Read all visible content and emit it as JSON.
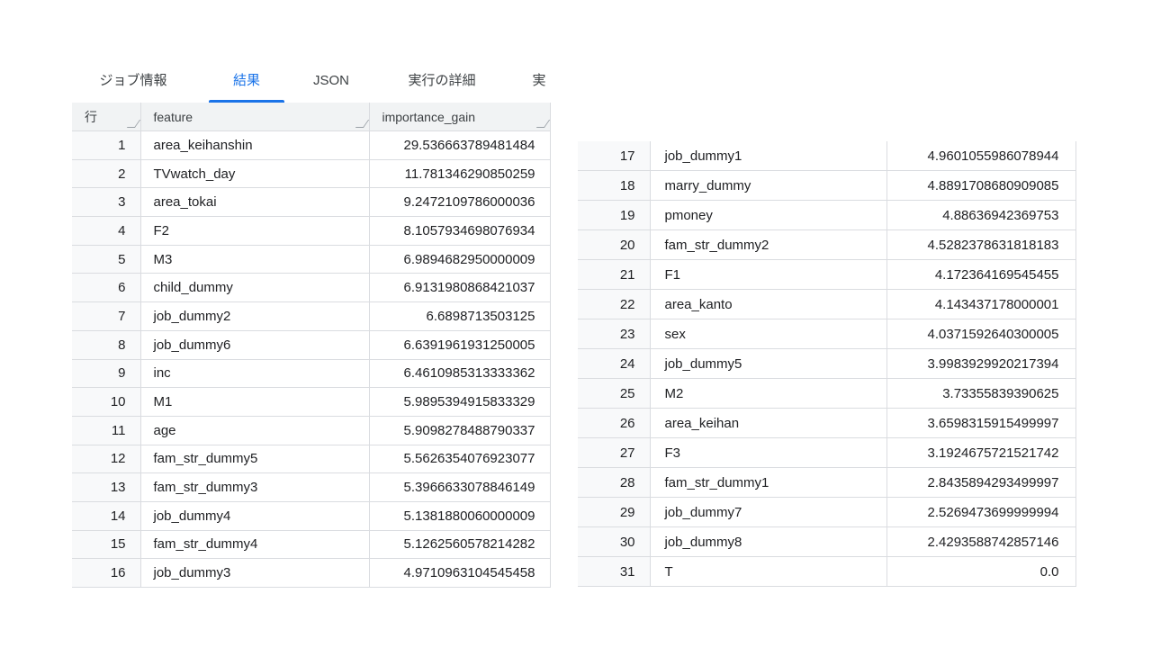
{
  "tabs": [
    {
      "label": "ジョブ情報",
      "active": false
    },
    {
      "label": "結果",
      "active": true
    },
    {
      "label": "JSON",
      "active": false
    },
    {
      "label": "実行の詳細",
      "active": false
    },
    {
      "label": "実",
      "active": false
    }
  ],
  "accent_color": "#1a73e8",
  "table": {
    "headers": [
      "行",
      "feature",
      "importance_gain"
    ],
    "left_rows": [
      {
        "no": "1",
        "feature": "area_keihanshin",
        "value": "29.536663789481484"
      },
      {
        "no": "2",
        "feature": "TVwatch_day",
        "value": "11.781346290850259"
      },
      {
        "no": "3",
        "feature": "area_tokai",
        "value": "9.2472109786000036"
      },
      {
        "no": "4",
        "feature": "F2",
        "value": "8.1057934698076934"
      },
      {
        "no": "5",
        "feature": "M3",
        "value": "6.9894682950000009"
      },
      {
        "no": "6",
        "feature": "child_dummy",
        "value": "6.9131980868421037"
      },
      {
        "no": "7",
        "feature": "job_dummy2",
        "value": "6.6898713503125"
      },
      {
        "no": "8",
        "feature": "job_dummy6",
        "value": "6.6391961931250005"
      },
      {
        "no": "9",
        "feature": "inc",
        "value": "6.4610985313333362"
      },
      {
        "no": "10",
        "feature": "M1",
        "value": "5.9895394915833329"
      },
      {
        "no": "11",
        "feature": "age",
        "value": "5.9098278488790337"
      },
      {
        "no": "12",
        "feature": "fam_str_dummy5",
        "value": "5.5626354076923077"
      },
      {
        "no": "13",
        "feature": "fam_str_dummy3",
        "value": "5.3966633078846149"
      },
      {
        "no": "14",
        "feature": "job_dummy4",
        "value": "5.1381880060000009"
      },
      {
        "no": "15",
        "feature": "fam_str_dummy4",
        "value": "5.1262560578214282"
      },
      {
        "no": "16",
        "feature": "job_dummy3",
        "value": "4.9710963104545458"
      }
    ],
    "right_rows": [
      {
        "no": "17",
        "feature": "job_dummy1",
        "value": "4.9601055986078944"
      },
      {
        "no": "18",
        "feature": "marry_dummy",
        "value": "4.8891708680909085"
      },
      {
        "no": "19",
        "feature": "pmoney",
        "value": "4.88636942369753"
      },
      {
        "no": "20",
        "feature": "fam_str_dummy2",
        "value": "4.5282378631818183"
      },
      {
        "no": "21",
        "feature": "F1",
        "value": "4.172364169545455"
      },
      {
        "no": "22",
        "feature": "area_kanto",
        "value": "4.143437178000001"
      },
      {
        "no": "23",
        "feature": "sex",
        "value": "4.0371592640300005"
      },
      {
        "no": "24",
        "feature": "job_dummy5",
        "value": "3.9983929920217394"
      },
      {
        "no": "25",
        "feature": "M2",
        "value": "3.73355839390625"
      },
      {
        "no": "26",
        "feature": "area_keihan",
        "value": "3.6598315915499997"
      },
      {
        "no": "27",
        "feature": "F3",
        "value": "3.1924675721521742"
      },
      {
        "no": "28",
        "feature": "fam_str_dummy1",
        "value": "2.8435894293499997"
      },
      {
        "no": "29",
        "feature": "job_dummy7",
        "value": "2.5269473699999994"
      },
      {
        "no": "30",
        "feature": "job_dummy8",
        "value": "2.4293588742857146"
      },
      {
        "no": "31",
        "feature": "T",
        "value": "0.0"
      }
    ]
  }
}
